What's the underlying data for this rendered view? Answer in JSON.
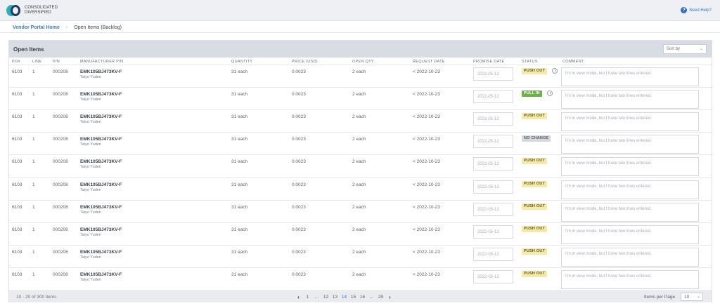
{
  "brand": {
    "line1": "CONSOLIDATED",
    "line2": "DIVERSIFIED"
  },
  "help": {
    "label": "Need Help?",
    "icon": "help-icon"
  },
  "breadcrumb": {
    "home": "Vendor Portal Home",
    "current": "Open Items (Backlog)"
  },
  "panel": {
    "title": "Open Items",
    "sort_placeholder": "Sort by",
    "columns": {
      "po": "PO#",
      "line": "LINE",
      "pn": "P/N",
      "mpn": "MANUFACTURER P/N",
      "qty": "QUANTITY",
      "price": "PRICE (USD)",
      "open": "OPEN QTY",
      "request": "REQUEST DATE",
      "promise": "PROMISE DATE",
      "status": "STATUS",
      "comment": "COMMENT"
    }
  },
  "rows": [
    {
      "po": "6103",
      "line": "1",
      "pn": "000208",
      "mpn": "EMK105BJ473KV-F",
      "mfr": "Taiyo Yuden",
      "qty": "31 each",
      "price": "0.0023",
      "open": "2 each",
      "request": "< 2022-10-23",
      "promise": "2022-05-12",
      "status": "PUSH OUT",
      "status_type": "push",
      "info": true,
      "comment": "I'm in view mode, but I have two lines entered."
    },
    {
      "po": "6103",
      "line": "1",
      "pn": "000208",
      "mpn": "EMK105BJ473KV-F",
      "mfr": "Taiyo Yuden",
      "qty": "31 each",
      "price": "0.0023",
      "open": "2 each",
      "request": "< 2022-10-23",
      "promise": "2022-05-12",
      "status": "PULL IN",
      "status_type": "pull",
      "info": true,
      "comment": "I'm in view mode, but I have two lines entered."
    },
    {
      "po": "6103",
      "line": "1",
      "pn": "000208",
      "mpn": "EMK105BJ473KV-F",
      "mfr": "Taiyo Yuden",
      "qty": "31 each",
      "price": "0.0023",
      "open": "2 each",
      "request": "< 2022-10-23",
      "promise": "2022-05-12",
      "status": "PUSH OUT",
      "status_type": "push",
      "info": false,
      "comment": "I'm in view mode, but I have two lines entered."
    },
    {
      "po": "6103",
      "line": "1",
      "pn": "000208",
      "mpn": "EMK105BJ473KV-F",
      "mfr": "Taiyo Yuden",
      "qty": "31 each",
      "price": "0.0023",
      "open": "2 each",
      "request": "< 2022-10-23",
      "promise": "2022-05-12",
      "status": "NO CHANGE",
      "status_type": "none",
      "info": false,
      "comment": "I'm in view mode, but I have two lines entered."
    },
    {
      "po": "6103",
      "line": "1",
      "pn": "000208",
      "mpn": "EMK105BJ473KV-F",
      "mfr": "Taiyo Yuden",
      "qty": "31 each",
      "price": "0.0023",
      "open": "2 each",
      "request": "< 2022-10-23",
      "promise": "2022-05-12",
      "status": "PUSH OUT",
      "status_type": "push",
      "info": false,
      "comment": "I'm in view mode, but I have two lines entered."
    },
    {
      "po": "6103",
      "line": "1",
      "pn": "000208",
      "mpn": "EMK105BJ473KV-F",
      "mfr": "Taiyo Yuden",
      "qty": "31 each",
      "price": "0.0023",
      "open": "2 each",
      "request": "< 2022-10-23",
      "promise": "2022-05-12",
      "status": "PUSH OUT",
      "status_type": "push",
      "info": false,
      "comment": "I'm in view mode, but I have two lines entered."
    },
    {
      "po": "6103",
      "line": "1",
      "pn": "000208",
      "mpn": "EMK105BJ473KV-F",
      "mfr": "Taiyo Yuden",
      "qty": "31 each",
      "price": "0.0023",
      "open": "2 each",
      "request": "< 2022-10-23",
      "promise": "2022-05-12",
      "status": "PUSH OUT",
      "status_type": "push",
      "info": false,
      "comment": "I'm in view mode, but I have two lines entered."
    },
    {
      "po": "6103",
      "line": "1",
      "pn": "000208",
      "mpn": "EMK105BJ473KV-F",
      "mfr": "Taiyo Yuden",
      "qty": "31 each",
      "price": "0.0023",
      "open": "2 each",
      "request": "< 2022-10-23",
      "promise": "2022-05-12",
      "status": "PUSH OUT",
      "status_type": "push",
      "info": false,
      "comment": "I'm in view mode, but I have two lines entered."
    },
    {
      "po": "6103",
      "line": "1",
      "pn": "000208",
      "mpn": "EMK105BJ473KV-F",
      "mfr": "Taiyo Yuden",
      "qty": "31 each",
      "price": "0.0023",
      "open": "2 each",
      "request": "< 2022-10-23",
      "promise": "2022-05-12",
      "status": "PUSH OUT",
      "status_type": "push",
      "info": false,
      "comment": "I'm in view mode, but I have two lines entered."
    },
    {
      "po": "6103",
      "line": "1",
      "pn": "000208",
      "mpn": "EMK105BJ473KV-F",
      "mfr": "Taiyo Yuden",
      "qty": "31 each",
      "price": "0.0023",
      "open": "2 each",
      "request": "< 2022-10-23",
      "promise": "2022-05-12",
      "status": "PUSH OUT",
      "status_type": "push",
      "info": false,
      "comment": "I'm in view mode, but I have two lines entered."
    }
  ],
  "footer": {
    "count": "10 - 20 of 300 items",
    "pages": [
      "1",
      "...",
      "12",
      "13",
      "14",
      "15",
      "16",
      "...",
      "29"
    ],
    "active_page": "14",
    "prev_icon": "chevron-left-icon",
    "next_icon": "chevron-right-icon",
    "items_per_page_label": "Items per Page",
    "items_per_page": "10"
  },
  "colors": {
    "accent": "#2e74c9",
    "push_out": "#f4e9a8",
    "pull_in": "#6cb04a",
    "no_change": "#d5d8dd",
    "brand_teal": "#2ab0b5",
    "brand_navy": "#1b3a6b"
  }
}
